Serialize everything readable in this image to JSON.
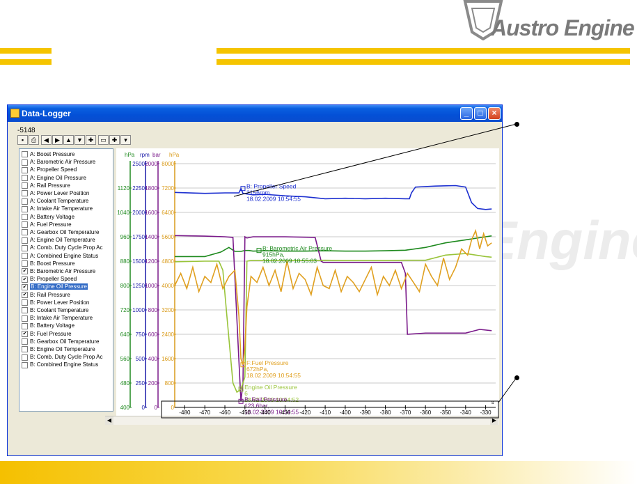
{
  "brand": {
    "logo_text": "Austro Engine",
    "watermark_text": "Engine"
  },
  "window": {
    "title": "Data-Logger",
    "counter": "-5148",
    "controls": {
      "minimize": "_",
      "maximize": "□",
      "close": "×"
    }
  },
  "toolbar": {
    "icons": [
      "save-icon",
      "print-icon",
      "arrow-left-icon",
      "arrow-right-icon",
      "arrow-up-icon",
      "arrow-down-icon",
      "zoom-in-icon",
      "zoom-fit-icon",
      "zoom-out-icon",
      "zoom-reset-icon"
    ]
  },
  "channels": [
    {
      "label": "A: Boost Pressure",
      "checked": false,
      "selected": false
    },
    {
      "label": "A: Barometric Air Pressure",
      "checked": false,
      "selected": false
    },
    {
      "label": "A: Propeller Speed",
      "checked": false,
      "selected": false
    },
    {
      "label": "A: Engine Oil Pressure",
      "checked": false,
      "selected": false
    },
    {
      "label": "A: Rail Pressure",
      "checked": false,
      "selected": false
    },
    {
      "label": "A: Power Lever Position",
      "checked": false,
      "selected": false
    },
    {
      "label": "A: Coolant Temperature",
      "checked": false,
      "selected": false
    },
    {
      "label": "A: Intake Air Temperature",
      "checked": false,
      "selected": false
    },
    {
      "label": "A: Battery Voltage",
      "checked": false,
      "selected": false
    },
    {
      "label": "A: Fuel Pressure",
      "checked": false,
      "selected": false
    },
    {
      "label": "A: Gearbox Oil Temperature",
      "checked": false,
      "selected": false
    },
    {
      "label": "A: Engine Oil Temperature",
      "checked": false,
      "selected": false
    },
    {
      "label": "A: Comb. Duty Cycle Prop Ac",
      "checked": false,
      "selected": false
    },
    {
      "label": "A: Combined Engine Status",
      "checked": false,
      "selected": false
    },
    {
      "label": "B: Boost Pressure",
      "checked": false,
      "selected": false
    },
    {
      "label": "B: Barometric Air Pressure",
      "checked": true,
      "selected": false
    },
    {
      "label": "B: Propeller Speed",
      "checked": true,
      "selected": false
    },
    {
      "label": "B: Engine Oil Pressure",
      "checked": true,
      "selected": true
    },
    {
      "label": "B: Rail Pressure",
      "checked": true,
      "selected": false
    },
    {
      "label": "B: Power Lever Position",
      "checked": false,
      "selected": false
    },
    {
      "label": "B: Coolant Temperature",
      "checked": false,
      "selected": false
    },
    {
      "label": "B: Intake Air Temperature",
      "checked": false,
      "selected": false
    },
    {
      "label": "B: Battery Voltage",
      "checked": false,
      "selected": false
    },
    {
      "label": "B: Fuel Pressure",
      "checked": true,
      "selected": false
    },
    {
      "label": "B: Gearbox Oil Temperature",
      "checked": false,
      "selected": false
    },
    {
      "label": "B: Engine Oil Temperature",
      "checked": false,
      "selected": false
    },
    {
      "label": "B: Comb. Duty Cycle Prop Ac",
      "checked": false,
      "selected": false
    },
    {
      "label": "B: Combined Engine Status",
      "checked": false,
      "selected": false
    }
  ],
  "chart_data": {
    "type": "line",
    "xlabel": "s",
    "xlim": [
      -485,
      -325
    ],
    "xticks": [
      -480,
      -470,
      -460,
      -450,
      -440,
      -430,
      -420,
      -410,
      -400,
      -390,
      -380,
      -370,
      -360,
      -350,
      -340,
      -330
    ],
    "axes": [
      {
        "unit": "hPa",
        "color": "#208a20",
        "ticks": [
          400,
          480,
          560,
          640,
          720,
          800,
          880,
          960,
          1040,
          1120
        ],
        "top_tick": "",
        "range": [
          400,
          1200
        ]
      },
      {
        "unit": "rpm",
        "color": "#1a1aa8",
        "ticks": [
          0,
          250,
          500,
          750,
          1000,
          1250,
          1500,
          1750,
          2000,
          2250,
          2500
        ],
        "range": [
          0,
          2500
        ]
      },
      {
        "unit": "bar",
        "color": "#7a1a8a",
        "ticks": [
          0,
          200,
          400,
          600,
          800,
          1000,
          1200,
          1400,
          1600,
          1800,
          2000
        ],
        "range": [
          0,
          2000
        ]
      },
      {
        "unit": "hPa",
        "color": "#d99a18",
        "ticks": [
          0,
          800,
          1600,
          2400,
          3200,
          4000,
          4800,
          5600,
          6400,
          7200,
          8000
        ],
        "range": [
          0,
          8000
        ]
      }
    ],
    "series": [
      {
        "name": "B: Propeller Speed",
        "color": "#1c2fd0",
        "axis": 1,
        "x": [
          -485,
          -470,
          -460,
          -453,
          -452,
          -451,
          -446,
          -440,
          -430,
          -420,
          -410,
          -400,
          -390,
          -380,
          -370,
          -368,
          -367,
          -365,
          -355,
          -345,
          -340,
          -337,
          -334,
          -330,
          -327
        ],
        "y": [
          2205,
          2195,
          2200,
          2200,
          2245,
          2195,
          2180,
          2185,
          2170,
          2160,
          2140,
          2145,
          2140,
          2145,
          2140,
          2140,
          2200,
          2260,
          2270,
          2275,
          2260,
          2100,
          2040,
          2030,
          2035
        ]
      },
      {
        "name": "B: Barometric Air Pressure",
        "color": "#1f8a1f",
        "axis": 0,
        "x": [
          -485,
          -470,
          -462,
          -458,
          -455,
          -452,
          -450,
          -448,
          -446,
          -440,
          -430,
          -420,
          -410,
          -400,
          -390,
          -380,
          -370,
          -360,
          -350,
          -340,
          -330,
          -327
        ],
        "y": [
          895,
          895,
          910,
          925,
          912,
          912,
          915,
          915,
          913,
          914,
          913,
          913,
          914,
          913,
          913,
          914,
          916,
          925,
          940,
          950,
          960,
          963
        ]
      },
      {
        "name": "B: Rail Pressure",
        "color": "#7a1a8a",
        "axis": 2,
        "x": [
          -485,
          -470,
          -460,
          -456,
          -453,
          -452,
          -451,
          -450,
          -449,
          -446,
          -440,
          -430,
          -415,
          -412,
          -411,
          -400,
          -390,
          -380,
          -372,
          -370,
          -369,
          -360,
          -350,
          -340,
          -333,
          -327
        ],
        "y": [
          1410,
          1405,
          1400,
          1395,
          380,
          50,
          200,
          1400,
          1390,
          1400,
          1400,
          1400,
          1395,
          1200,
          1190,
          1190,
          1190,
          1190,
          1190,
          1100,
          600,
          610,
          610,
          610,
          640,
          630
        ]
      },
      {
        "name": "B: Engine Oil Pressure",
        "color": "#99c43a",
        "axis": 0,
        "x": [
          -485,
          -470,
          -463,
          -461,
          -459,
          -456,
          -454,
          -452,
          -450,
          -449,
          -447,
          -440,
          -430,
          -420,
          -410,
          -400,
          -390,
          -380,
          -370,
          -360,
          -350,
          -340,
          -330,
          -327
        ],
        "y": [
          878,
          880,
          880,
          850,
          700,
          480,
          450,
          460,
          500,
          880,
          882,
          882,
          882,
          882,
          883,
          882,
          882,
          882,
          883,
          883,
          900,
          905,
          895,
          893
        ]
      },
      {
        "name": "B: Fuel Pressure",
        "color": "#e0a020",
        "axis": 3,
        "x": [
          -485,
          -482,
          -479,
          -476,
          -473,
          -470,
          -467,
          -464,
          -461,
          -458,
          -455,
          -453,
          -452,
          -451,
          -450,
          -449,
          -447,
          -444,
          -441,
          -438,
          -435,
          -432,
          -429,
          -426,
          -423,
          -420,
          -417,
          -414,
          -411,
          -408,
          -405,
          -402,
          -399,
          -396,
          -393,
          -390,
          -387,
          -384,
          -381,
          -378,
          -375,
          -372,
          -369,
          -366,
          -363,
          -360,
          -357,
          -354,
          -351,
          -348,
          -345,
          -342,
          -339,
          -337,
          -335,
          -333,
          -331,
          -329,
          -327
        ],
        "y": [
          4000,
          4400,
          3900,
          4600,
          3800,
          4300,
          4100,
          4700,
          3900,
          4300,
          4500,
          3000,
          1600,
          1400,
          2000,
          3300,
          4300,
          4100,
          4600,
          4000,
          4500,
          3800,
          4800,
          3900,
          4400,
          4200,
          3700,
          4600,
          4000,
          3900,
          4500,
          3800,
          4300,
          4100,
          3800,
          4200,
          4600,
          3700,
          4300,
          4000,
          4500,
          3900,
          4400,
          4100,
          3800,
          4700,
          4300,
          4000,
          4900,
          4200,
          4600,
          5200,
          5000,
          5500,
          5800,
          5200,
          5700,
          5300,
          5400
        ]
      }
    ],
    "annotations": [
      {
        "series": "B: Propeller Speed",
        "lines": [
          "B: Propeller Speed",
          "2156rpm,",
          "18.02.2009 10:54:55"
        ],
        "x": -451,
        "y": 2245,
        "color": "#1c2fd0"
      },
      {
        "series": "B: Barometric Air Pressure",
        "lines": [
          "B: Barometric Air Pressure",
          "915hPa,",
          "18.02.2009 10:55:03"
        ],
        "x": -443,
        "y": 915,
        "color": "#1f8a1f"
      },
      {
        "series": "B: Fuel Pressure",
        "lines": [
          "F:Fuel Pressure",
          "672hPa,",
          "18.02.2009 10:54:55"
        ],
        "x": -451,
        "y": 1400,
        "color": "#e0a020"
      },
      {
        "series": "B: Engine Oil Pressure",
        "lines": [
          "Engine Oil Pressure",
          "6",
          "18.02.2009 10:54:52"
        ],
        "x": -452,
        "y": 460,
        "color": "#99c43a"
      },
      {
        "series": "B: Rail Pressure",
        "lines": [
          "B: Rail Pressure",
          "123,6bar,",
          "18.02.2009 10:54:55"
        ],
        "x": -452,
        "y": 50,
        "color": "#7a1a8a"
      }
    ],
    "grid": true,
    "legend": "none"
  }
}
